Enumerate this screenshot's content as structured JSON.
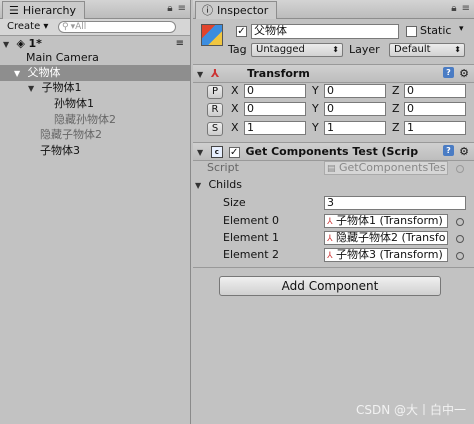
{
  "hierarchy": {
    "tab_label": "Hierarchy",
    "create_label": "Create ▾",
    "search_placeholder": "▾All",
    "scene_name": "1*",
    "items": [
      {
        "label": "Main Camera"
      },
      {
        "label": "父物体"
      },
      {
        "label": "子物体1"
      },
      {
        "label": "孙物体1"
      },
      {
        "label": "隐藏孙物体2"
      },
      {
        "label": "隐藏子物体2"
      },
      {
        "label": "子物体3"
      }
    ]
  },
  "inspector": {
    "tab_label": "Inspector",
    "object_name": "父物体",
    "static_label": "Static",
    "tag_label": "Tag",
    "tag_value": "Untagged",
    "layer_label": "Layer",
    "layer_value": "Default",
    "transform": {
      "title": "Transform",
      "position": {
        "btn": "P",
        "x": "0",
        "y": "0",
        "z": "0"
      },
      "rotation": {
        "btn": "R",
        "x": "0",
        "y": "0",
        "z": "0"
      },
      "scale": {
        "btn": "S",
        "x": "1",
        "y": "1",
        "z": "1"
      },
      "x_label": "X",
      "y_label": "Y",
      "z_label": "Z"
    },
    "script_component": {
      "title": "Get Components Test (Scrip",
      "script_label": "Script",
      "script_value": "GetComponentsTes",
      "childs_label": "Childs",
      "size_label": "Size",
      "size_value": "3",
      "elements": [
        {
          "label": "Element 0",
          "value": "子物体1 (Transform)"
        },
        {
          "label": "Element 1",
          "value": "隐藏子物体2 (Transfo"
        },
        {
          "label": "Element 2",
          "value": "子物体3 (Transform)"
        }
      ]
    },
    "add_component_label": "Add Component"
  },
  "watermark": "CSDN @大丨白中一"
}
